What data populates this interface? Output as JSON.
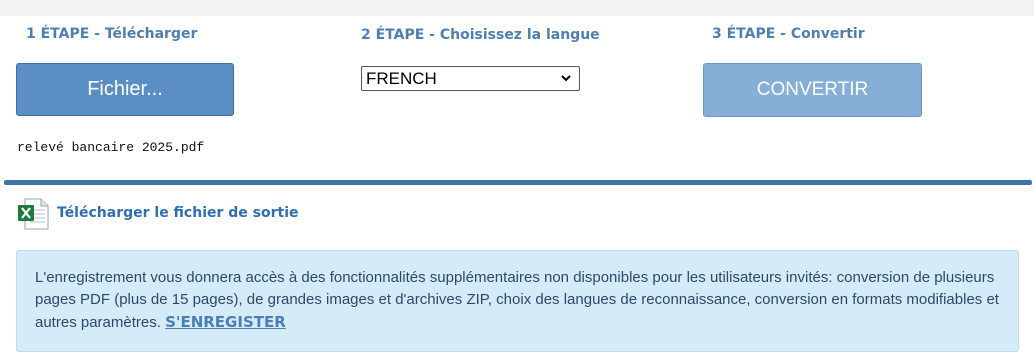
{
  "steps": {
    "step1_title": "1 ÉTAPE - Télécharger",
    "step2_title": "2 ÉTAPE - Choisissez la langue",
    "step3_title": "3 ÉTAPE - Convertir"
  },
  "upload": {
    "button_label": "Fichier...",
    "selected_file": "relevé bancaire 2025.pdf"
  },
  "language": {
    "selected": "FRENCH"
  },
  "convert": {
    "button_label": "CONVERTIR"
  },
  "output": {
    "icon": "excel-file-icon",
    "download_label": "Télécharger le fichier de sortie"
  },
  "info": {
    "text": "L'enregistrement vous donnera accès à des fonctionnalités supplémentaires non disponibles pour les utilisateurs invités: conversion de plusieurs pages PDF (plus de 15 pages), de grandes images et d'archives ZIP, choix des langues de reconnaissance, conversion en formats modifiables et autres paramètres.",
    "register_label": "S'ENREGISTER"
  },
  "colors": {
    "accent": "#5b8fc4",
    "step_title": "#4f7fae",
    "divider": "#3f76a8",
    "info_bg": "#d6ebf8"
  }
}
